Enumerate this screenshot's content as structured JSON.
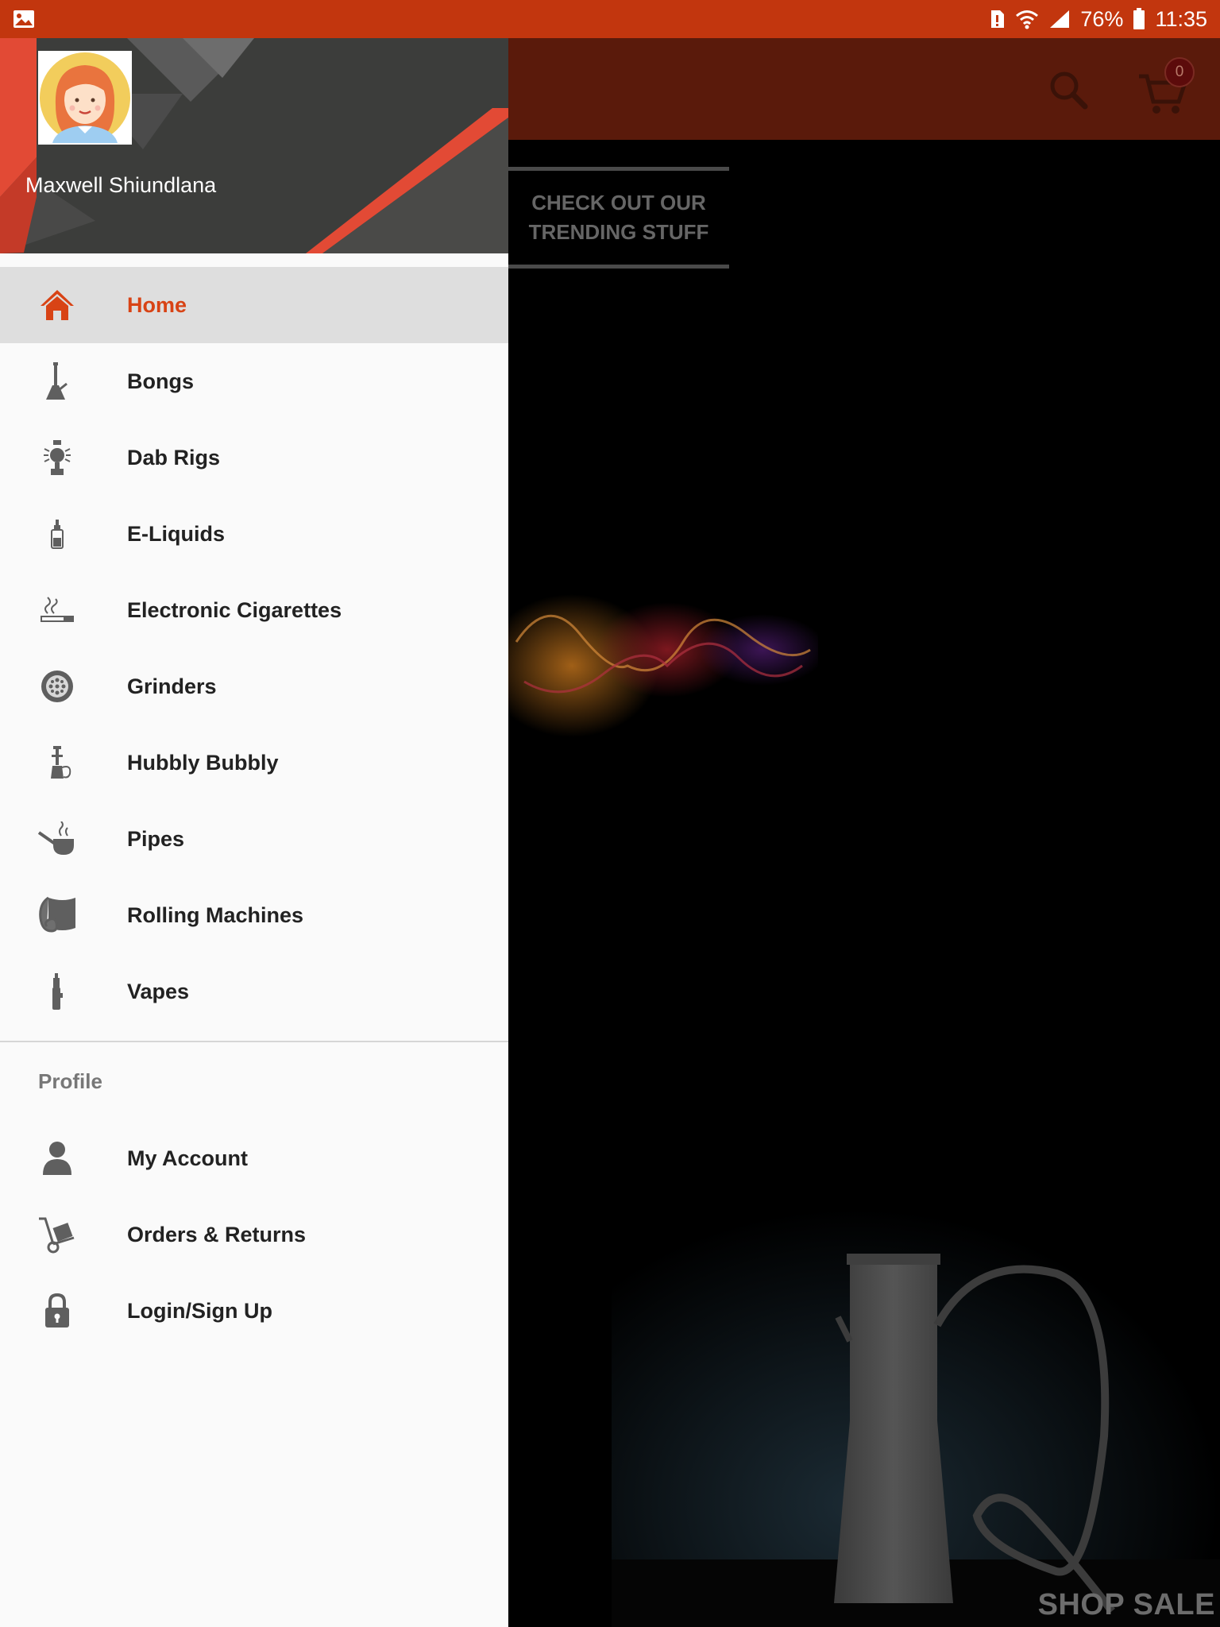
{
  "status_bar": {
    "battery_percent": "76%",
    "time": "11:35"
  },
  "app": {
    "cart_count": "0",
    "trending_text": "CHECK OUT OUR\nTRENDING STUFF",
    "shop_sale": "SHOP SALE"
  },
  "drawer": {
    "user_name": "Maxwell Shiundlana",
    "categories": [
      {
        "label": "Home",
        "icon": "home-icon",
        "active": true
      },
      {
        "label": "Bongs",
        "icon": "bong-icon"
      },
      {
        "label": "Dab Rigs",
        "icon": "dab-rig-icon"
      },
      {
        "label": "E-Liquids",
        "icon": "e-liquid-bottle-icon"
      },
      {
        "label": "Electronic Cigarettes",
        "icon": "cigarette-icon"
      },
      {
        "label": "Grinders",
        "icon": "grinder-icon"
      },
      {
        "label": "Hubbly Bubbly",
        "icon": "hookah-icon"
      },
      {
        "label": "Pipes",
        "icon": "pipe-icon"
      },
      {
        "label": "Rolling Machines",
        "icon": "rolling-paper-icon"
      },
      {
        "label": "Vapes",
        "icon": "vape-pen-icon"
      }
    ],
    "profile_section": {
      "title": "Profile",
      "items": [
        {
          "label": "My Account",
          "icon": "user-icon"
        },
        {
          "label": "Orders & Returns",
          "icon": "hand-truck-icon"
        },
        {
          "label": "Login/Sign Up",
          "icon": "lock-icon"
        }
      ]
    }
  },
  "colors": {
    "status_bar": "#c2360e",
    "accent": "#d84315",
    "drawer_bg": "#fafafa",
    "active_item_bg": "#dedede",
    "icon_grey": "#5f5f5f"
  }
}
